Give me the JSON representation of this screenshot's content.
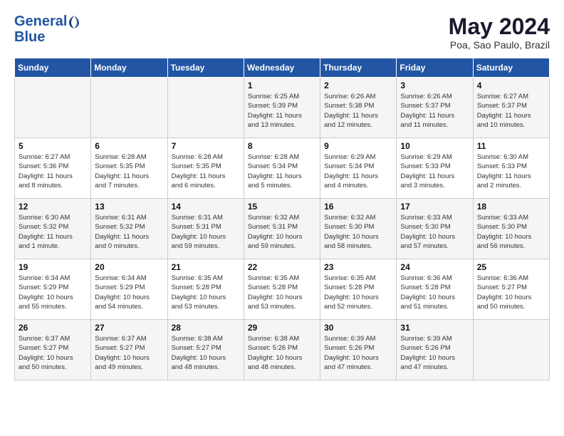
{
  "logo": {
    "line1": "General",
    "line2": "Blue"
  },
  "title": "May 2024",
  "location": "Poa, Sao Paulo, Brazil",
  "weekdays": [
    "Sunday",
    "Monday",
    "Tuesday",
    "Wednesday",
    "Thursday",
    "Friday",
    "Saturday"
  ],
  "weeks": [
    [
      {
        "day": "",
        "info": ""
      },
      {
        "day": "",
        "info": ""
      },
      {
        "day": "",
        "info": ""
      },
      {
        "day": "1",
        "info": "Sunrise: 6:25 AM\nSunset: 5:39 PM\nDaylight: 11 hours\nand 13 minutes."
      },
      {
        "day": "2",
        "info": "Sunrise: 6:26 AM\nSunset: 5:38 PM\nDaylight: 11 hours\nand 12 minutes."
      },
      {
        "day": "3",
        "info": "Sunrise: 6:26 AM\nSunset: 5:37 PM\nDaylight: 11 hours\nand 11 minutes."
      },
      {
        "day": "4",
        "info": "Sunrise: 6:27 AM\nSunset: 5:37 PM\nDaylight: 11 hours\nand 10 minutes."
      }
    ],
    [
      {
        "day": "5",
        "info": "Sunrise: 6:27 AM\nSunset: 5:36 PM\nDaylight: 11 hours\nand 8 minutes."
      },
      {
        "day": "6",
        "info": "Sunrise: 6:28 AM\nSunset: 5:35 PM\nDaylight: 11 hours\nand 7 minutes."
      },
      {
        "day": "7",
        "info": "Sunrise: 6:28 AM\nSunset: 5:35 PM\nDaylight: 11 hours\nand 6 minutes."
      },
      {
        "day": "8",
        "info": "Sunrise: 6:28 AM\nSunset: 5:34 PM\nDaylight: 11 hours\nand 5 minutes."
      },
      {
        "day": "9",
        "info": "Sunrise: 6:29 AM\nSunset: 5:34 PM\nDaylight: 11 hours\nand 4 minutes."
      },
      {
        "day": "10",
        "info": "Sunrise: 6:29 AM\nSunset: 5:33 PM\nDaylight: 11 hours\nand 3 minutes."
      },
      {
        "day": "11",
        "info": "Sunrise: 6:30 AM\nSunset: 5:33 PM\nDaylight: 11 hours\nand 2 minutes."
      }
    ],
    [
      {
        "day": "12",
        "info": "Sunrise: 6:30 AM\nSunset: 5:32 PM\nDaylight: 11 hours\nand 1 minute."
      },
      {
        "day": "13",
        "info": "Sunrise: 6:31 AM\nSunset: 5:32 PM\nDaylight: 11 hours\nand 0 minutes."
      },
      {
        "day": "14",
        "info": "Sunrise: 6:31 AM\nSunset: 5:31 PM\nDaylight: 10 hours\nand 59 minutes."
      },
      {
        "day": "15",
        "info": "Sunrise: 6:32 AM\nSunset: 5:31 PM\nDaylight: 10 hours\nand 59 minutes."
      },
      {
        "day": "16",
        "info": "Sunrise: 6:32 AM\nSunset: 5:30 PM\nDaylight: 10 hours\nand 58 minutes."
      },
      {
        "day": "17",
        "info": "Sunrise: 6:33 AM\nSunset: 5:30 PM\nDaylight: 10 hours\nand 57 minutes."
      },
      {
        "day": "18",
        "info": "Sunrise: 6:33 AM\nSunset: 5:30 PM\nDaylight: 10 hours\nand 56 minutes."
      }
    ],
    [
      {
        "day": "19",
        "info": "Sunrise: 6:34 AM\nSunset: 5:29 PM\nDaylight: 10 hours\nand 55 minutes."
      },
      {
        "day": "20",
        "info": "Sunrise: 6:34 AM\nSunset: 5:29 PM\nDaylight: 10 hours\nand 54 minutes."
      },
      {
        "day": "21",
        "info": "Sunrise: 6:35 AM\nSunset: 5:28 PM\nDaylight: 10 hours\nand 53 minutes."
      },
      {
        "day": "22",
        "info": "Sunrise: 6:35 AM\nSunset: 5:28 PM\nDaylight: 10 hours\nand 53 minutes."
      },
      {
        "day": "23",
        "info": "Sunrise: 6:35 AM\nSunset: 5:28 PM\nDaylight: 10 hours\nand 52 minutes."
      },
      {
        "day": "24",
        "info": "Sunrise: 6:36 AM\nSunset: 5:28 PM\nDaylight: 10 hours\nand 51 minutes."
      },
      {
        "day": "25",
        "info": "Sunrise: 6:36 AM\nSunset: 5:27 PM\nDaylight: 10 hours\nand 50 minutes."
      }
    ],
    [
      {
        "day": "26",
        "info": "Sunrise: 6:37 AM\nSunset: 5:27 PM\nDaylight: 10 hours\nand 50 minutes."
      },
      {
        "day": "27",
        "info": "Sunrise: 6:37 AM\nSunset: 5:27 PM\nDaylight: 10 hours\nand 49 minutes."
      },
      {
        "day": "28",
        "info": "Sunrise: 6:38 AM\nSunset: 5:27 PM\nDaylight: 10 hours\nand 48 minutes."
      },
      {
        "day": "29",
        "info": "Sunrise: 6:38 AM\nSunset: 5:26 PM\nDaylight: 10 hours\nand 48 minutes."
      },
      {
        "day": "30",
        "info": "Sunrise: 6:39 AM\nSunset: 5:26 PM\nDaylight: 10 hours\nand 47 minutes."
      },
      {
        "day": "31",
        "info": "Sunrise: 6:39 AM\nSunset: 5:26 PM\nDaylight: 10 hours\nand 47 minutes."
      },
      {
        "day": "",
        "info": ""
      }
    ]
  ]
}
